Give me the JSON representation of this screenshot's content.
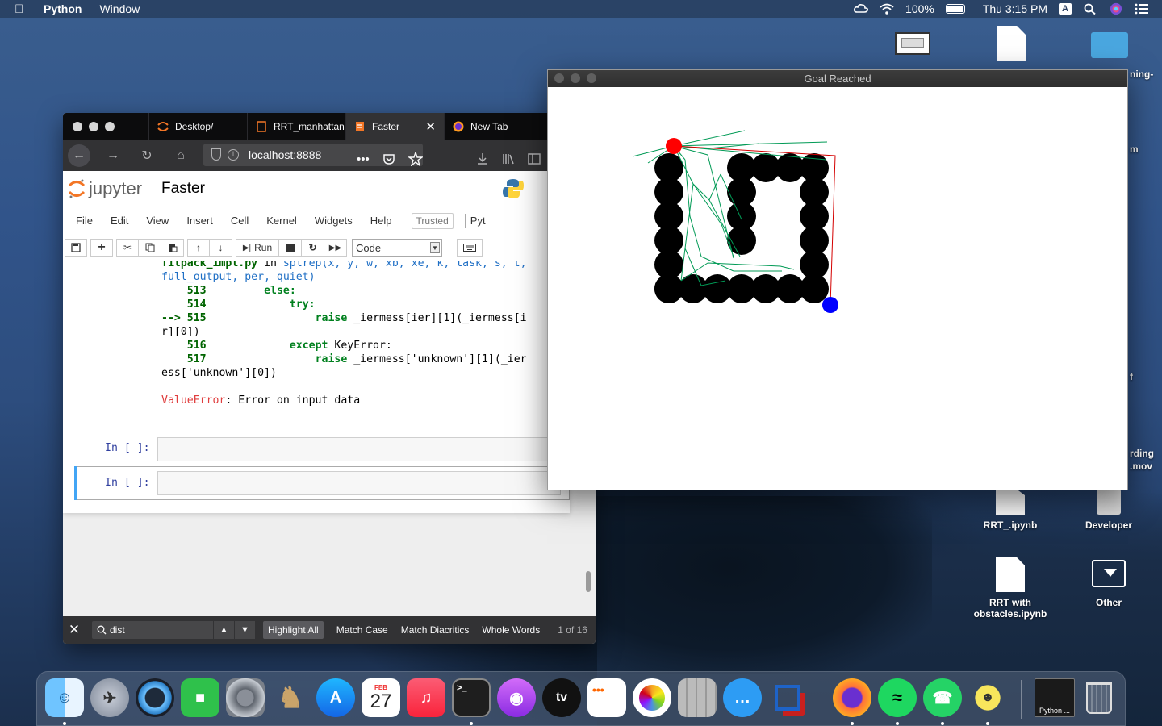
{
  "menubar": {
    "app_name": "Python",
    "menus": [
      "Window"
    ],
    "battery": "100%",
    "clock": "Thu 3:15 PM",
    "input_source": "A"
  },
  "desktop": {
    "icons": [
      {
        "label": "RRT_.ipynb",
        "icon": "notebook-file-icon"
      },
      {
        "label": "Developer",
        "icon": "drive-icon"
      },
      {
        "label": "RRT with obstacles.ipynb",
        "icon": "notebook-file-icon"
      },
      {
        "label": "Other",
        "icon": "download-folder-icon"
      }
    ],
    "partial_labels": [
      "ning-",
      "m",
      "f",
      "rding",
      ".mov"
    ]
  },
  "browser": {
    "tabs": [
      {
        "label": "Desktop/",
        "icon": "jupyter-tab-icon",
        "active": false
      },
      {
        "label": "RRT_manhattan",
        "icon": "notebook-tab-icon",
        "active": false
      },
      {
        "label": "Faster",
        "icon": "notebook-tab-icon",
        "active": true
      },
      {
        "label": "New Tab",
        "icon": "firefox-icon",
        "active": false
      }
    ],
    "url": "localhost:8888",
    "url_more": "•••"
  },
  "jupyter": {
    "logo_text": "jupyter",
    "notebook_title": "Faster",
    "menu": [
      "File",
      "Edit",
      "View",
      "Insert",
      "Cell",
      "Kernel",
      "Widgets",
      "Help"
    ],
    "trusted": "Trusted",
    "kernel_partial": "Pyt",
    "toolbar": {
      "run_label": "Run",
      "cell_type": "Code"
    },
    "traceback": {
      "line1_file": "fitpack_impl.py",
      "line1_in": " in ",
      "line1_func": "splrep",
      "line1_args": "(x, y, w, xb, xe, k, task, s, t,",
      "line2": "full_output, per, quiet)",
      "l513": "513",
      "l513_kw": "else:",
      "l514": "514",
      "l514_kw": "try:",
      "arrow": "--> 515",
      "raise": "raise",
      "l515_code": " _iermess[ier][1](_iermess[i",
      "l515_cont": "r][0])",
      "l516": "516",
      "l516_kw": "except",
      "l516_code": " KeyError:",
      "l517": "517",
      "l517_code": " _iermess['unknown'][1](_ier",
      "l517_cont": "ess['unknown'][0])",
      "error_name": "ValueError",
      "error_msg": ": Error on input data"
    },
    "prompts": [
      "In [ ]:",
      "In [ ]:"
    ]
  },
  "findbar": {
    "query": "dist",
    "highlight_all": "Highlight All",
    "match_case": "Match Case",
    "match_diacritics": "Match Diacritics",
    "whole_words": "Whole Words",
    "count": "1 of 16"
  },
  "game_window": {
    "title": "Goal Reached",
    "colors": {
      "start": "#ff0000",
      "goal": "#0000ff",
      "tree": "#009a55",
      "path": "#d40000",
      "obstacle": "#000000"
    }
  },
  "dock": {
    "apps": [
      "Finder",
      "Launchpad",
      "QuickTime Player",
      "FaceTime",
      "System Preferences",
      "Chess",
      "App Store",
      "Calendar",
      "Music",
      "Terminal",
      "Podcasts",
      "TV",
      "Reminders",
      "Photos",
      "Calculator",
      "Messages",
      "VirtualBox",
      "Firefox",
      "Spotify",
      "WhatsApp",
      "Python",
      "Terminal Window",
      "Trash"
    ],
    "calendar_month": "FEB",
    "calendar_day": "27",
    "tv_label": "tv",
    "python_window_label": "Python ..."
  }
}
